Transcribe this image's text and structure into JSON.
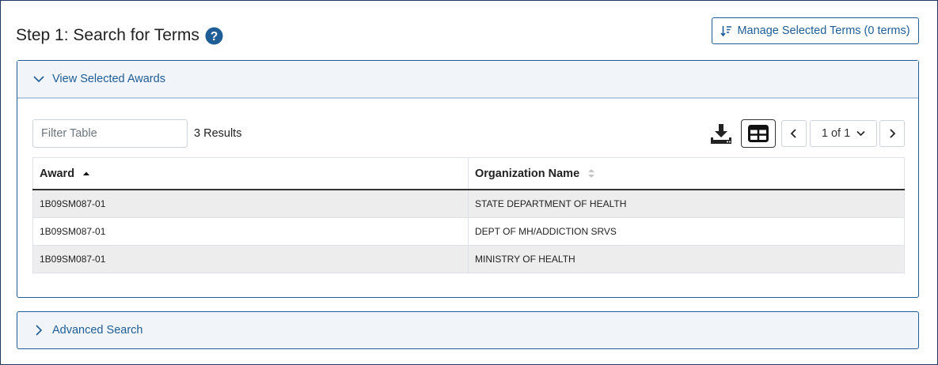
{
  "page": {
    "title": "Step 1: Search for Terms",
    "manage_button_label": "Manage Selected Terms (0 terms)"
  },
  "selected_awards_panel": {
    "header_label": "View Selected Awards",
    "filter_placeholder": "Filter Table",
    "results_text": "3 Results",
    "pagination": {
      "current": "1 of 1"
    },
    "table": {
      "columns": [
        "Award",
        "Organization Name"
      ],
      "rows": [
        [
          "1B09SM087-01",
          "STATE DEPARTMENT OF HEALTH"
        ],
        [
          "1B09SM087-01",
          "DEPT OF MH/ADDICTION SRVS"
        ],
        [
          "1B09SM087-01",
          "MINISTRY OF HEALTH"
        ]
      ]
    }
  },
  "advanced_search_panel": {
    "header_label": "Advanced Search"
  },
  "colors": {
    "accent": "#1f5d96",
    "help_icon": "#1f5d96",
    "header_bg": "#f1f4f8",
    "striped_row": "#ededed"
  },
  "icons": {
    "help": "question-circle-icon",
    "manage": "sort-list-icon",
    "expand": "chevron-down-icon",
    "collapse": "chevron-right-icon",
    "download": "download-icon",
    "columns": "table-columns-icon",
    "prev": "chevron-left-icon",
    "next": "chevron-right-icon",
    "sort_asc": "sort-up-icon",
    "sort_none": "sort-icon"
  }
}
